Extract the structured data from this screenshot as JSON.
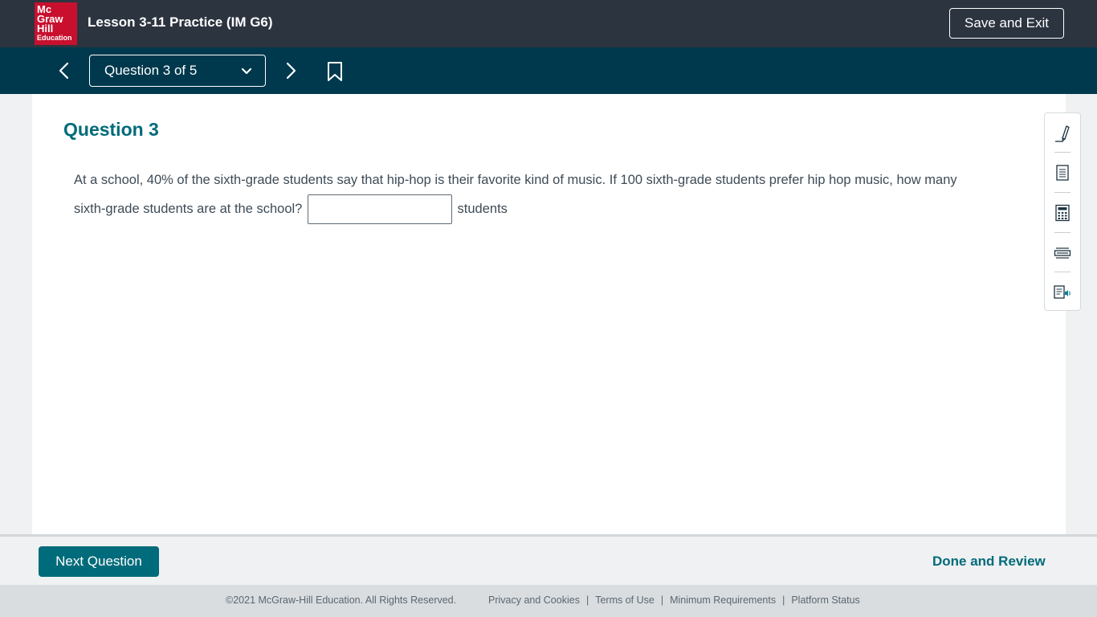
{
  "header": {
    "logo_lines": [
      "Mc",
      "Graw",
      "Hill",
      "Education"
    ],
    "title": "Lesson 3-11 Practice (IM G6)",
    "save_exit_label": "Save and Exit"
  },
  "nav": {
    "question_selector_label": "Question 3 of 5",
    "prev_icon": "chevron-left-icon",
    "next_icon": "chevron-right-icon",
    "bookmark_icon": "bookmark-icon"
  },
  "question": {
    "heading": "Question 3",
    "text_part1": "At a school, 40% of the sixth-grade students say that hip-hop is their favorite kind of music. If 100 sixth-grade students prefer hip hop music, how many sixth-grade students are at the school?",
    "answer_value": "",
    "unit": "students"
  },
  "tools": [
    {
      "icon": "highlighter-pen-icon"
    },
    {
      "icon": "notepad-icon"
    },
    {
      "icon": "calculator-icon"
    },
    {
      "icon": "line-reader-icon"
    },
    {
      "icon": "text-to-speech-icon"
    }
  ],
  "actions": {
    "next_label": "Next Question",
    "done_label": "Done and Review"
  },
  "footer": {
    "copyright": "©2021 McGraw-Hill Education. All Rights Reserved.",
    "links": [
      "Privacy and Cookies",
      "Terms of Use",
      "Minimum Requirements",
      "Platform Status"
    ]
  },
  "colors": {
    "topbar": "#2c3440",
    "navbar": "#00394d",
    "accent": "#006b7a",
    "brand_red": "#c8102e"
  }
}
